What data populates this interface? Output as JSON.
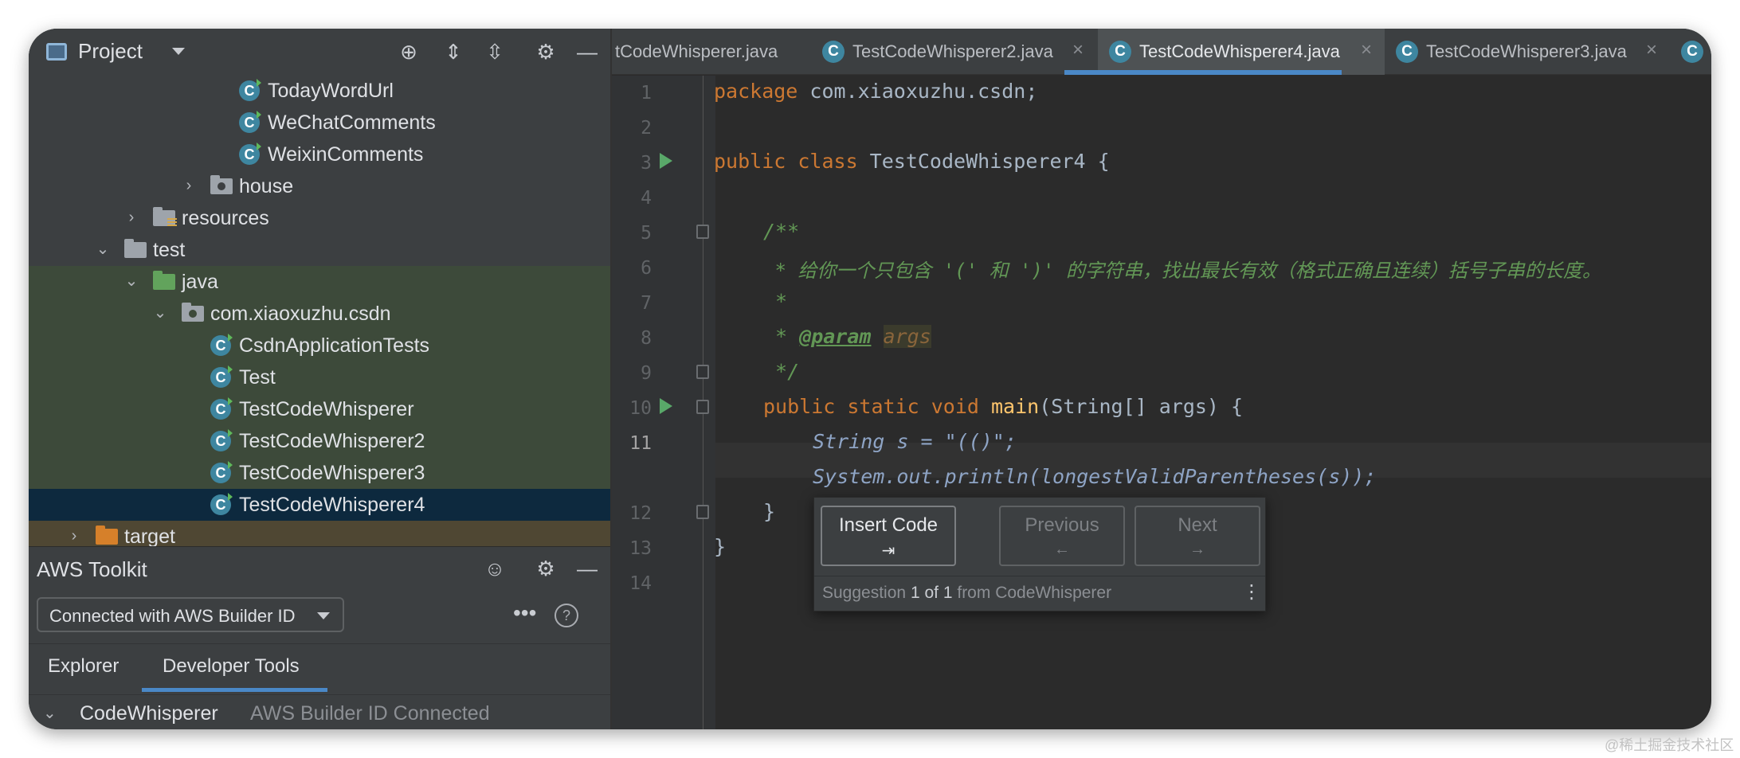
{
  "project_panel": {
    "title": "Project",
    "tree": [
      {
        "label": "TodayWordUrl",
        "icon": "class"
      },
      {
        "label": "WeChatComments",
        "icon": "class"
      },
      {
        "label": "WeixinComments",
        "icon": "class"
      },
      {
        "label": "house",
        "icon": "package"
      },
      {
        "label": "resources",
        "icon": "resources-folder"
      },
      {
        "label": "test",
        "icon": "folder"
      },
      {
        "label": "java",
        "icon": "test-folder"
      },
      {
        "label": "com.xiaoxuzhu.csdn",
        "icon": "package"
      },
      {
        "label": "CsdnApplicationTests",
        "icon": "class"
      },
      {
        "label": "Test",
        "icon": "class"
      },
      {
        "label": "TestCodeWhisperer",
        "icon": "class"
      },
      {
        "label": "TestCodeWhisperer2",
        "icon": "class"
      },
      {
        "label": "TestCodeWhisperer3",
        "icon": "class"
      },
      {
        "label": "TestCodeWhisperer4",
        "icon": "class",
        "selected": true
      },
      {
        "label": "target",
        "icon": "excluded-folder"
      }
    ]
  },
  "aws_toolkit": {
    "title": "AWS Toolkit",
    "connection": "Connected with AWS Builder ID",
    "tabs": [
      "Explorer",
      "Developer Tools"
    ],
    "active_tab": "Developer Tools",
    "codewhisperer": {
      "name": "CodeWhisperer",
      "status": "AWS Builder ID Connected"
    }
  },
  "editor": {
    "tabs": [
      {
        "label": "tCodeWhisperer.java",
        "active": false
      },
      {
        "label": "TestCodeWhisperer2.java",
        "active": false
      },
      {
        "label": "TestCodeWhisperer4.java",
        "active": true
      },
      {
        "label": "TestCodeWhisperer3.java",
        "active": false
      }
    ],
    "line_numbers": [
      "1",
      "2",
      "3",
      "4",
      "5",
      "6",
      "7",
      "8",
      "9",
      "10",
      "11",
      "12",
      "13",
      "14"
    ],
    "current_line": "11",
    "code": {
      "l1_kw": "package",
      "l1_rest": " com.xiaoxuzhu.csdn;",
      "l3_kw": "public class",
      "l3_rest": " TestCodeWhisperer4 {",
      "l5": "/**",
      "l6": " * 给你一个只包含 '(' 和 ')' 的字符串，找出最长有效（格式正确且连续）括号子串的长度。",
      "l7": " *",
      "l8_star": " * ",
      "l8_tag": "@param",
      "l8_arg": "args",
      "l9": " */",
      "l10_kw": "public static void",
      "l10_fn": "main",
      "l10_rest": "(String[] args) {",
      "l11_ghost": "String s = \"(()\";",
      "l11b_ghost": "System.out.println(longestValidParentheses(s));",
      "l12": "}",
      "l13": "}"
    }
  },
  "suggestion_popup": {
    "insert_label": "Insert Code",
    "insert_shortcut": "⇥",
    "previous_label": "Previous",
    "previous_shortcut": "←",
    "next_label": "Next",
    "next_shortcut": "→",
    "footer_prefix": "Suggestion",
    "footer_index": "1",
    "footer_of": "of",
    "footer_total": "1",
    "footer_source": "from CodeWhisperer"
  },
  "watermark": "@稀土掘金技术社区"
}
